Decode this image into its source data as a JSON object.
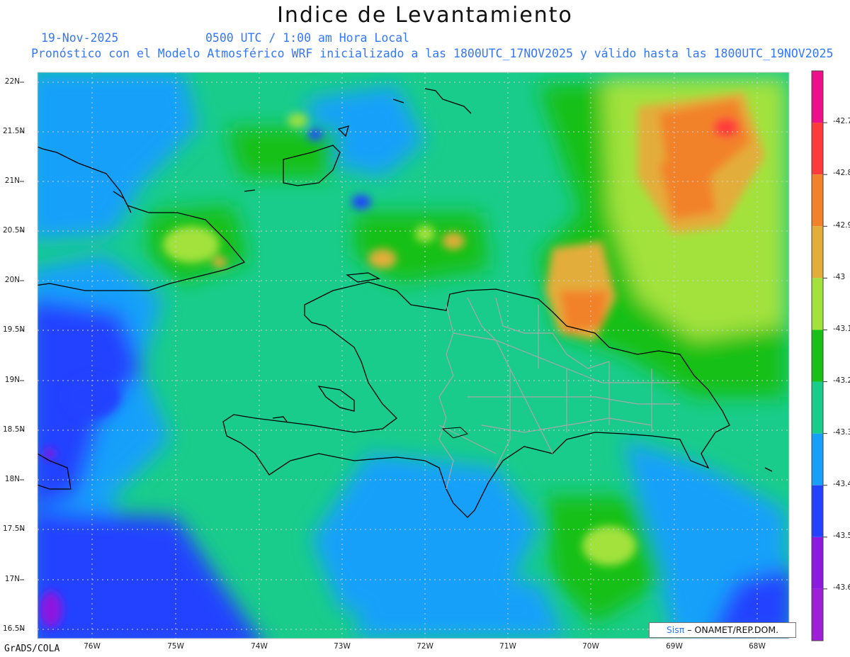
{
  "title": "Indice de Levantamiento",
  "date": "19-Nov-2025",
  "time_label": "0500 UTC / 1:00 am Hora Local",
  "forecast_line": "Pronóstico con el Modelo Atmosférico WRF inicializado a las 1800UTC_17NOV2025 y válido hasta las  1800UTC_19NOV2025",
  "lat_labels": [
    "22N",
    "21.5N",
    "21N",
    "20.5N",
    "20N",
    "19.5N",
    "19N",
    "18.5N",
    "18N",
    "17.5N",
    "17N",
    "16.5N"
  ],
  "lon_labels": [
    "76W",
    "75W",
    "74W",
    "73W",
    "72W",
    "71W",
    "70W",
    "69W",
    "68W"
  ],
  "colorbar": {
    "labels": [
      "-42.7",
      "-42.8",
      "-42.9",
      "-43",
      "-43.1",
      "-43.2",
      "-43.3",
      "-43.4",
      "-43.5",
      "-43.6"
    ],
    "colors": [
      "#ee0f8a",
      "#ff3b3b",
      "#f2822a",
      "#e3ad3a",
      "#a3e23d",
      "#18c018",
      "#19cc8b",
      "#16a0fa",
      "#2342ff",
      "#8c19e0",
      "#9d20d6"
    ]
  },
  "credit_sis": "Sisπ",
  "credit_rest": "– ONAMET/REP.DOM.",
  "software": "GrADS/COLA"
}
